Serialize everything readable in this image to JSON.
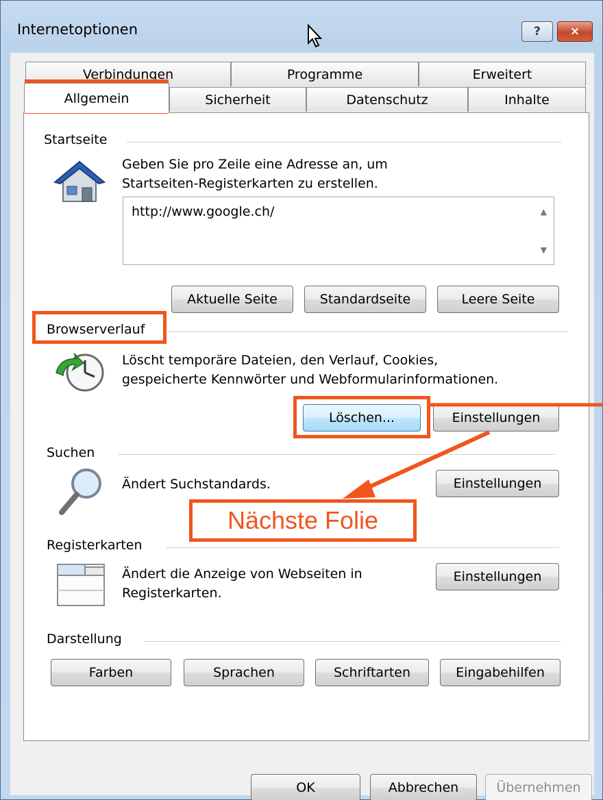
{
  "window": {
    "title": "Internetoptionen",
    "help_label": "?",
    "close_label": "×"
  },
  "tabs_back": [
    "Verbindungen",
    "Programme",
    "Erweitert"
  ],
  "tabs_front": [
    "Allgemein",
    "Sicherheit",
    "Datenschutz",
    "Inhalte"
  ],
  "startseite": {
    "label": "Startseite",
    "desc_line1": "Geben Sie pro Zeile eine Adresse an, um",
    "desc_line2": "Startseiten-Registerkarten zu erstellen.",
    "value": "http://www.google.ch/",
    "btn_current": "Aktuelle Seite",
    "btn_default": "Standardseite",
    "btn_blank": "Leere Seite"
  },
  "browserverlauf": {
    "label": "Browserverlauf",
    "desc_line1": "Löscht temporäre Dateien, den Verlauf, Cookies,",
    "desc_line2": "gespeicherte Kennwörter und Webformularinformationen.",
    "btn_delete": "Löschen...",
    "btn_settings": "Einstellungen"
  },
  "suchen": {
    "label": "Suchen",
    "desc": "Ändert Suchstandards.",
    "btn_settings": "Einstellungen"
  },
  "registerkarten": {
    "label": "Registerkarten",
    "desc_line1": "Ändert die Anzeige von Webseiten in",
    "desc_line2": "Registerkarten.",
    "btn_settings": "Einstellungen"
  },
  "darstellung": {
    "label": "Darstellung",
    "btn_colors": "Farben",
    "btn_languages": "Sprachen",
    "btn_fonts": "Schriftarten",
    "btn_accessibility": "Eingabehilfen"
  },
  "footer": {
    "ok": "OK",
    "cancel": "Abbrechen",
    "apply": "Übernehmen"
  },
  "annotation": {
    "text": "Nächste Folie",
    "color": "#f0561e"
  }
}
